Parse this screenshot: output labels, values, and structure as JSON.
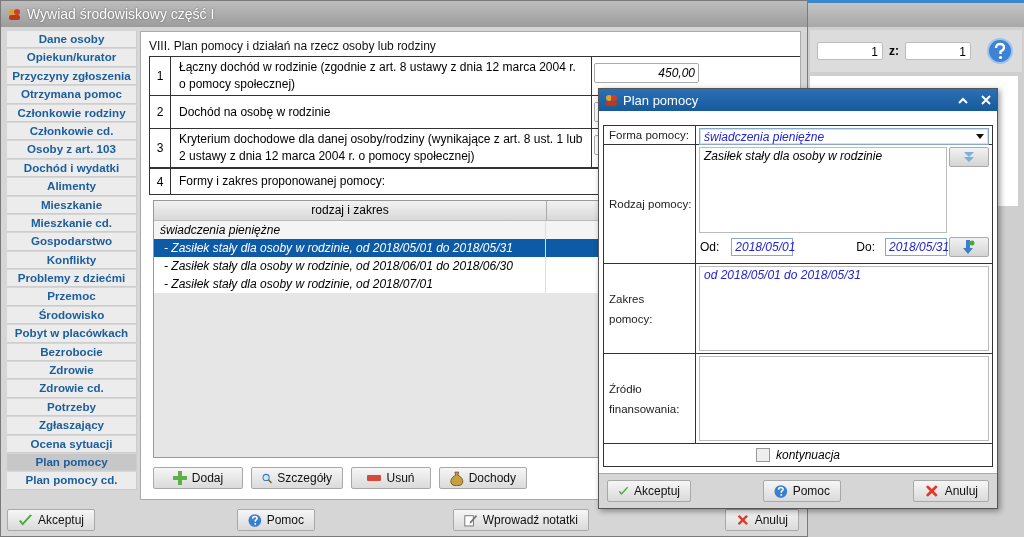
{
  "main_window": {
    "title": "Wywiad środowiskowy część I",
    "sidebar": {
      "items": [
        {
          "label": "Dane osoby",
          "selected": false
        },
        {
          "label": "Opiekun/kurator",
          "selected": false
        },
        {
          "label": "Przyczyny zgłoszenia",
          "selected": false
        },
        {
          "label": "Otrzymana pomoc",
          "selected": false
        },
        {
          "label": "Członkowie rodziny",
          "selected": false
        },
        {
          "label": "Członkowie cd.",
          "selected": false
        },
        {
          "label": "Osoby z art. 103",
          "selected": false
        },
        {
          "label": "Dochód i wydatki",
          "selected": false
        },
        {
          "label": "Alimenty",
          "selected": false
        },
        {
          "label": "Mieszkanie",
          "selected": false
        },
        {
          "label": "Mieszkanie cd.",
          "selected": false
        },
        {
          "label": "Gospodarstwo",
          "selected": false
        },
        {
          "label": "Konflikty",
          "selected": false
        },
        {
          "label": "Problemy z dziećmi",
          "selected": false
        },
        {
          "label": "Przemoc",
          "selected": false
        },
        {
          "label": "Środowisko",
          "selected": false
        },
        {
          "label": "Pobyt w placówkach",
          "selected": false
        },
        {
          "label": "Bezrobocie",
          "selected": false
        },
        {
          "label": "Zdrowie",
          "selected": false
        },
        {
          "label": "Zdrowie cd.",
          "selected": false
        },
        {
          "label": "Potrzeby",
          "selected": false
        },
        {
          "label": "Zgłaszający",
          "selected": false
        },
        {
          "label": "Ocena sytuacji",
          "selected": false
        },
        {
          "label": "Plan pomocy",
          "selected": true
        },
        {
          "label": "Plan pomocy cd.",
          "selected": false
        }
      ]
    },
    "section_title": "VIII. Plan pomocy i działań na rzecz osoby lub rodziny",
    "income_rows": [
      {
        "number": "1",
        "label": "Łączny dochód w rodzinie (zgodnie z art. 8  ustawy z dnia 12 marca 2004 r. o pomocy społecznej)",
        "value": "450,00"
      },
      {
        "number": "2",
        "label": "Dochód na osobę w rodzinie"
      },
      {
        "number": "3",
        "label": "Kryterium dochodowe dla danej osoby/rodziny (wynikające z art. 8 ust. 1 lub 2 ustawy z dnia 12 marca 2004 r. o pomocy społecznej)"
      }
    ],
    "plan_heading": {
      "number": "4",
      "label": "Formy i zakres proponowanej pomocy:"
    },
    "plan_table": {
      "columns": [
        "rodzaj i zakres"
      ],
      "rows": [
        {
          "text": "świadczenia pieniężne",
          "kind": "group",
          "selected": false
        },
        {
          "text": "- Zasiłek stały dla osoby w rodzinie, od 2018/05/01 do 2018/05/31",
          "kind": "item",
          "selected": true
        },
        {
          "text": "- Zasiłek stały dla osoby w rodzinie, od 2018/06/01 do 2018/06/30",
          "kind": "item",
          "selected": false
        },
        {
          "text": "- Zasiłek stały dla osoby w rodzinie, od 2018/07/01",
          "kind": "item",
          "selected": false
        }
      ]
    },
    "list_buttons": [
      {
        "label": "Dodaj",
        "kind": "add"
      },
      {
        "label": "Szczegóły",
        "kind": "details"
      },
      {
        "label": "Usuń",
        "kind": "remove"
      },
      {
        "label": "Dochody",
        "kind": "income"
      }
    ],
    "footer_buttons": [
      {
        "label": "Akceptuj",
        "kind": "accept"
      },
      {
        "label": "Pomoc",
        "kind": "help"
      },
      {
        "label": "Wprowadź notatki",
        "kind": "notes"
      },
      {
        "label": "Anuluj",
        "kind": "cancel"
      }
    ]
  },
  "back_window": {
    "page_field": "1",
    "of_label": "z:",
    "total_field": "1"
  },
  "dialog": {
    "title": "Plan pomocy",
    "forma": {
      "label": "Forma pomocy:",
      "value": "świadczenia pieniężne"
    },
    "rodzaj": {
      "label": "Rodzaj pomocy:",
      "value": "Zasiłek stały dla osoby w rodzinie"
    },
    "od": {
      "label": "Od:",
      "value": "2018/05/01"
    },
    "do": {
      "label": "Do:",
      "value": "2018/05/31"
    },
    "zakres": {
      "label": "Zakres pomocy:",
      "value": "od 2018/05/01 do 2018/05/31"
    },
    "zrodlo": {
      "label": "Źródło finansowania:"
    },
    "kontynuacja": {
      "label": "kontynuacja",
      "checked": false
    },
    "buttons": [
      {
        "label": "Akceptuj",
        "kind": "accept"
      },
      {
        "label": "Pomoc",
        "kind": "help"
      },
      {
        "label": "Anuluj",
        "kind": "cancel"
      }
    ]
  }
}
